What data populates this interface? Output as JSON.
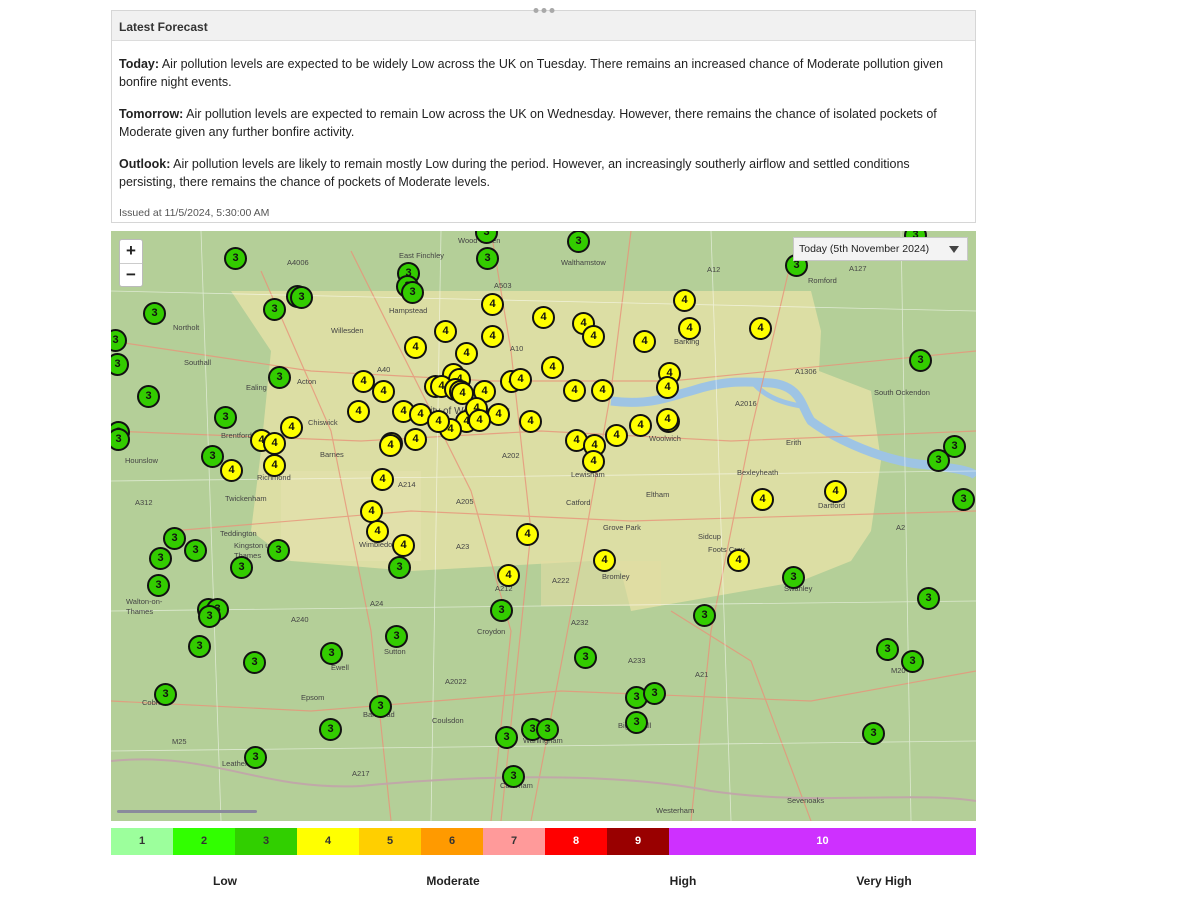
{
  "forecast": {
    "header": "Latest Forecast",
    "today_label": "Today:",
    "today_text": " Air pollution levels are expected to be widely Low across the UK on Tuesday. There remains an increased chance of Moderate pollution given bonfire night events.",
    "tomorrow_label": "Tomorrow:",
    "tomorrow_text": " Air pollution levels are expected to remain Low across the UK on Wednesday. However, there remains the chance of isolated pockets of Moderate given any further bonfire activity.",
    "outlook_label": "Outlook:",
    "outlook_text": " Air pollution levels are likely to remain mostly Low during the period. However, an increasingly southerly airflow and settled conditions persisting, there remains the chance of pockets of Moderate levels.",
    "issued": "Issued at 11/5/2024, 5:30:00 AM"
  },
  "map": {
    "zoom_in": "+",
    "zoom_out": "−",
    "day_select": "Today (5th November 2024)",
    "labels": [
      "East Finchley",
      "Wood Green",
      "Walthamstow",
      "Romford",
      "A4006",
      "A503",
      "A12",
      "A127",
      "Hampstead",
      "Willesden",
      "Northolt",
      "Southall",
      "Ealing",
      "Acton",
      "Chiswick",
      "A40",
      "City of Westminster",
      "A10",
      "Barking",
      "A1306",
      "A2016",
      "South Ockendon",
      "Woolwich",
      "Erith",
      "Bexleyheath",
      "Dartford",
      "A312",
      "Twickenham",
      "Richmond",
      "Barnes",
      "Lewisham",
      "Catford",
      "Eltham",
      "Grove Park",
      "Sidcup",
      "Foots Cray",
      "Bromley",
      "A202",
      "A214",
      "A205",
      "A23",
      "A222",
      "A212",
      "A24",
      "A232",
      "A233",
      "A240",
      "A21",
      "Swanley",
      "Teddington",
      "Kingston upon Thames",
      "Wimbledon",
      "Croydon",
      "Sutton",
      "Ewell",
      "Epsom",
      "Coulsdon",
      "Cobham",
      "Leatherhead",
      "Banstead",
      "Warlingham",
      "Caterham",
      "Biggin Hill",
      "Westerham",
      "Sevenoaks",
      "M20",
      "M25",
      "A217",
      "A2022",
      "A2",
      "Walton-on-Thames",
      "Hounslow",
      "Brentford"
    ],
    "markers": [
      {
        "v": 3,
        "x": 0.143,
        "y": 0.045
      },
      {
        "v": 3,
        "x": 0.435,
        "y": 0.045
      },
      {
        "v": 3,
        "x": 0.54,
        "y": 0.017
      },
      {
        "v": 3,
        "x": 0.433,
        "y": -0.002
      },
      {
        "v": 3,
        "x": 0.93,
        "y": 0.006
      },
      {
        "v": 3,
        "x": 0.792,
        "y": 0.058
      },
      {
        "v": 3,
        "x": 0.343,
        "y": 0.072
      },
      {
        "v": 3,
        "x": 0.342,
        "y": 0.093
      },
      {
        "v": 3,
        "x": 0.348,
        "y": 0.103
      },
      {
        "v": 3,
        "x": 0.215,
        "y": 0.11
      },
      {
        "v": 3,
        "x": 0.22,
        "y": 0.112
      },
      {
        "v": 3,
        "x": 0.188,
        "y": 0.133
      },
      {
        "v": 3,
        "x": 0.05,
        "y": 0.139
      },
      {
        "v": 3,
        "x": 0.005,
        "y": 0.185
      },
      {
        "v": 3,
        "x": 0.007,
        "y": 0.226
      },
      {
        "v": 3,
        "x": 0.194,
        "y": 0.247
      },
      {
        "v": 3,
        "x": 0.043,
        "y": 0.28
      },
      {
        "v": 3,
        "x": 0.132,
        "y": 0.316
      },
      {
        "v": 3,
        "x": 0.008,
        "y": 0.34
      },
      {
        "v": 3,
        "x": 0.008,
        "y": 0.353
      },
      {
        "v": 3,
        "x": 0.117,
        "y": 0.381
      },
      {
        "v": 3,
        "x": 0.935,
        "y": 0.218
      },
      {
        "v": 3,
        "x": 0.974,
        "y": 0.364
      },
      {
        "v": 3,
        "x": 0.956,
        "y": 0.388
      },
      {
        "v": 3,
        "x": 0.985,
        "y": 0.455
      },
      {
        "v": 3,
        "x": 0.073,
        "y": 0.52
      },
      {
        "v": 3,
        "x": 0.097,
        "y": 0.54
      },
      {
        "v": 3,
        "x": 0.193,
        "y": 0.54
      },
      {
        "v": 3,
        "x": 0.057,
        "y": 0.555
      },
      {
        "v": 3,
        "x": 0.15,
        "y": 0.57
      },
      {
        "v": 3,
        "x": 0.333,
        "y": 0.57
      },
      {
        "v": 3,
        "x": 0.054,
        "y": 0.6
      },
      {
        "v": 3,
        "x": 0.112,
        "y": 0.64
      },
      {
        "v": 3,
        "x": 0.123,
        "y": 0.64
      },
      {
        "v": 3,
        "x": 0.113,
        "y": 0.652
      },
      {
        "v": 3,
        "x": 0.102,
        "y": 0.704
      },
      {
        "v": 3,
        "x": 0.165,
        "y": 0.73
      },
      {
        "v": 3,
        "x": 0.254,
        "y": 0.715
      },
      {
        "v": 3,
        "x": 0.329,
        "y": 0.687
      },
      {
        "v": 3,
        "x": 0.451,
        "y": 0.643
      },
      {
        "v": 3,
        "x": 0.686,
        "y": 0.651
      },
      {
        "v": 3,
        "x": 0.788,
        "y": 0.586
      },
      {
        "v": 3,
        "x": 0.945,
        "y": 0.622
      },
      {
        "v": 3,
        "x": 0.897,
        "y": 0.709
      },
      {
        "v": 3,
        "x": 0.926,
        "y": 0.728
      },
      {
        "v": 3,
        "x": 0.548,
        "y": 0.722
      },
      {
        "v": 3,
        "x": 0.063,
        "y": 0.785
      },
      {
        "v": 3,
        "x": 0.311,
        "y": 0.805
      },
      {
        "v": 3,
        "x": 0.253,
        "y": 0.844
      },
      {
        "v": 3,
        "x": 0.487,
        "y": 0.844
      },
      {
        "v": 3,
        "x": 0.607,
        "y": 0.79
      },
      {
        "v": 3,
        "x": 0.628,
        "y": 0.783
      },
      {
        "v": 3,
        "x": 0.607,
        "y": 0.833
      },
      {
        "v": 3,
        "x": 0.457,
        "y": 0.857
      },
      {
        "v": 3,
        "x": 0.504,
        "y": 0.844
      },
      {
        "v": 3,
        "x": 0.881,
        "y": 0.851
      },
      {
        "v": 3,
        "x": 0.166,
        "y": 0.892
      },
      {
        "v": 3,
        "x": 0.465,
        "y": 0.923
      },
      {
        "v": 4,
        "x": 0.441,
        "y": 0.123
      },
      {
        "v": 4,
        "x": 0.499,
        "y": 0.145
      },
      {
        "v": 4,
        "x": 0.546,
        "y": 0.156
      },
      {
        "v": 4,
        "x": 0.557,
        "y": 0.178
      },
      {
        "v": 4,
        "x": 0.663,
        "y": 0.117
      },
      {
        "v": 4,
        "x": 0.668,
        "y": 0.165
      },
      {
        "v": 4,
        "x": 0.75,
        "y": 0.165
      },
      {
        "v": 4,
        "x": 0.386,
        "y": 0.17
      },
      {
        "v": 4,
        "x": 0.44,
        "y": 0.178
      },
      {
        "v": 4,
        "x": 0.352,
        "y": 0.196
      },
      {
        "v": 4,
        "x": 0.41,
        "y": 0.207
      },
      {
        "v": 4,
        "x": 0.616,
        "y": 0.187
      },
      {
        "v": 4,
        "x": 0.645,
        "y": 0.24
      },
      {
        "v": 4,
        "x": 0.643,
        "y": 0.265
      },
      {
        "v": 4,
        "x": 0.51,
        "y": 0.23
      },
      {
        "v": 4,
        "x": 0.395,
        "y": 0.243
      },
      {
        "v": 4,
        "x": 0.375,
        "y": 0.262
      },
      {
        "v": 4,
        "x": 0.402,
        "y": 0.25
      },
      {
        "v": 4,
        "x": 0.463,
        "y": 0.255
      },
      {
        "v": 4,
        "x": 0.473,
        "y": 0.25
      },
      {
        "v": 4,
        "x": 0.381,
        "y": 0.263
      },
      {
        "v": 4,
        "x": 0.291,
        "y": 0.255
      },
      {
        "v": 4,
        "x": 0.315,
        "y": 0.272
      },
      {
        "v": 4,
        "x": 0.398,
        "y": 0.268
      },
      {
        "v": 4,
        "x": 0.403,
        "y": 0.272
      },
      {
        "v": 4,
        "x": 0.406,
        "y": 0.275
      },
      {
        "v": 4,
        "x": 0.431,
        "y": 0.272
      },
      {
        "v": 4,
        "x": 0.535,
        "y": 0.27
      },
      {
        "v": 4,
        "x": 0.568,
        "y": 0.27
      },
      {
        "v": 4,
        "x": 0.286,
        "y": 0.305
      },
      {
        "v": 4,
        "x": 0.338,
        "y": 0.305
      },
      {
        "v": 4,
        "x": 0.357,
        "y": 0.31
      },
      {
        "v": 4,
        "x": 0.41,
        "y": 0.322
      },
      {
        "v": 4,
        "x": 0.392,
        "y": 0.336
      },
      {
        "v": 4,
        "x": 0.351,
        "y": 0.352
      },
      {
        "v": 4,
        "x": 0.324,
        "y": 0.359
      },
      {
        "v": 4,
        "x": 0.323,
        "y": 0.363
      },
      {
        "v": 4,
        "x": 0.378,
        "y": 0.322
      },
      {
        "v": 4,
        "x": 0.422,
        "y": 0.3
      },
      {
        "v": 4,
        "x": 0.447,
        "y": 0.31
      },
      {
        "v": 4,
        "x": 0.425,
        "y": 0.32
      },
      {
        "v": 4,
        "x": 0.484,
        "y": 0.322
      },
      {
        "v": 4,
        "x": 0.208,
        "y": 0.332
      },
      {
        "v": 4,
        "x": 0.173,
        "y": 0.355
      },
      {
        "v": 4,
        "x": 0.189,
        "y": 0.359
      },
      {
        "v": 4,
        "x": 0.139,
        "y": 0.405
      },
      {
        "v": 4,
        "x": 0.189,
        "y": 0.396
      },
      {
        "v": 4,
        "x": 0.537,
        "y": 0.355
      },
      {
        "v": 4,
        "x": 0.558,
        "y": 0.363
      },
      {
        "v": 4,
        "x": 0.584,
        "y": 0.346
      },
      {
        "v": 4,
        "x": 0.612,
        "y": 0.329
      },
      {
        "v": 4,
        "x": 0.644,
        "y": 0.322
      },
      {
        "v": 4,
        "x": 0.643,
        "y": 0.318
      },
      {
        "v": 4,
        "x": 0.557,
        "y": 0.389
      },
      {
        "v": 4,
        "x": 0.313,
        "y": 0.42
      },
      {
        "v": 4,
        "x": 0.301,
        "y": 0.474
      },
      {
        "v": 4,
        "x": 0.308,
        "y": 0.509
      },
      {
        "v": 4,
        "x": 0.337,
        "y": 0.532
      },
      {
        "v": 4,
        "x": 0.481,
        "y": 0.514
      },
      {
        "v": 4,
        "x": 0.459,
        "y": 0.583
      },
      {
        "v": 4,
        "x": 0.57,
        "y": 0.557
      },
      {
        "v": 4,
        "x": 0.753,
        "y": 0.455
      },
      {
        "v": 4,
        "x": 0.837,
        "y": 0.44
      },
      {
        "v": 4,
        "x": 0.725,
        "y": 0.557
      }
    ]
  },
  "legend": {
    "bands": [
      {
        "label": "1",
        "color": "#9cff9c"
      },
      {
        "label": "2",
        "color": "#31ff00"
      },
      {
        "label": "3",
        "color": "#31cf00"
      },
      {
        "label": "4",
        "color": "#ffff00"
      },
      {
        "label": "5",
        "color": "#ffcf00"
      },
      {
        "label": "6",
        "color": "#ff9a00"
      },
      {
        "label": "7",
        "color": "#ff9a9a"
      },
      {
        "label": "8",
        "color": "#ff0000"
      },
      {
        "label": "9",
        "color": "#990000"
      },
      {
        "label": "10",
        "color": "#ce30ff"
      }
    ],
    "categories": [
      "Low",
      "Moderate",
      "High",
      "Very High"
    ]
  }
}
